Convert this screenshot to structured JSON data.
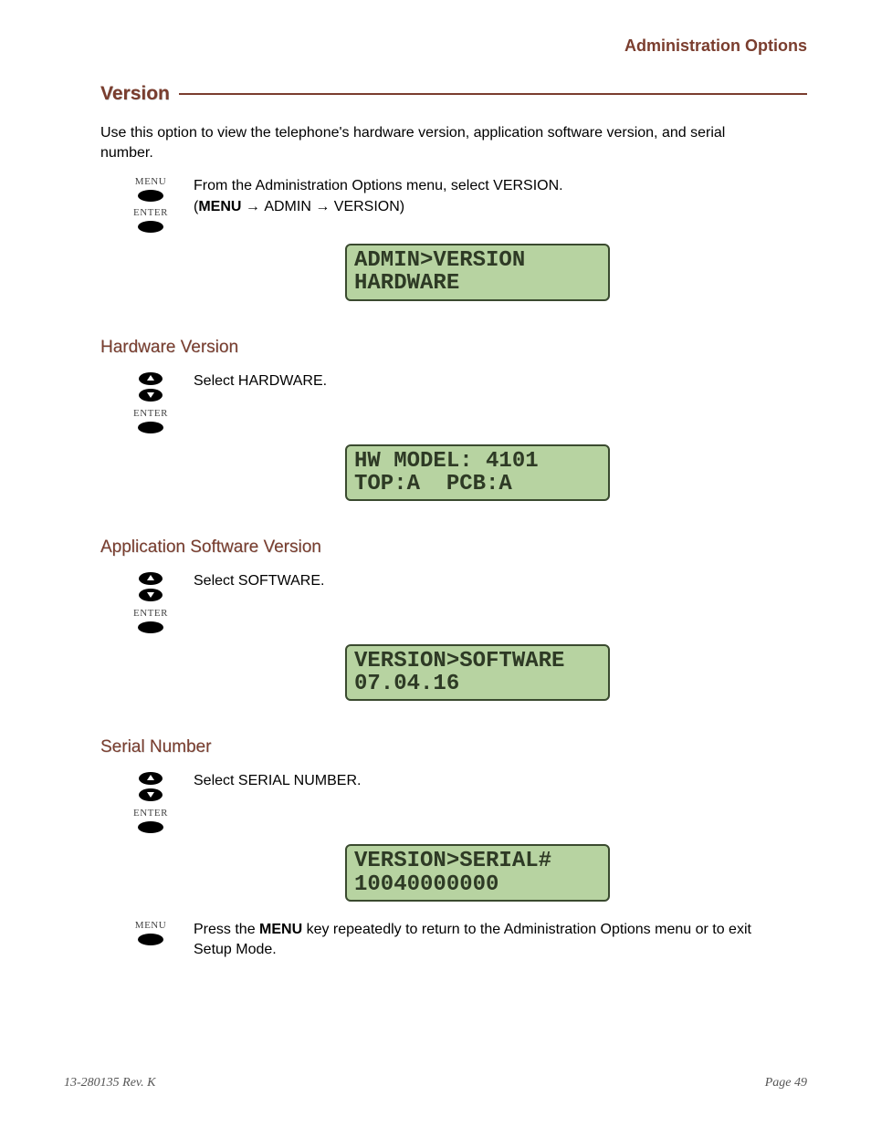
{
  "header": {
    "title": "Administration Options"
  },
  "section": {
    "title": "Version"
  },
  "intro": "Use this option to view the telephone's hardware version, application software version, and serial number.",
  "step_version": {
    "key1_label": "MENU",
    "key2_label": "ENTER",
    "text_before": "From the Administration Options menu, select VERSION.",
    "path_prefix": "(",
    "path_menu": "MENU",
    "path_sep": " → ",
    "path_admin": "ADMIN",
    "path_version": "VERSION",
    "path_suffix": ")",
    "lcd_line1": "ADMIN>VERSION",
    "lcd_line2": "HARDWARE"
  },
  "hardware": {
    "title": "Hardware Version",
    "key_enter": "ENTER",
    "text": "Select HARDWARE.",
    "lcd_line1": "HW MODEL: 4101",
    "lcd_line2": "TOP:A  PCB:A"
  },
  "software": {
    "title": "Application Software Version",
    "key_enter": "ENTER",
    "text": "Select SOFTWARE.",
    "lcd_line1": "VERSION>SOFTWARE",
    "lcd_line2": "07.04.16"
  },
  "serial": {
    "title": "Serial Number",
    "key_enter": "ENTER",
    "text": "Select SERIAL NUMBER.",
    "lcd_line1": "VERSION>SERIAL#",
    "lcd_line2": "10040000000"
  },
  "exit": {
    "key_label": "MENU",
    "text_before": "Press the ",
    "text_bold": "MENU",
    "text_after": " key repeatedly to return to the Administration Options menu or to exit Setup Mode."
  },
  "footer": {
    "left": "13-280135  Rev. K",
    "right": "Page 49"
  }
}
